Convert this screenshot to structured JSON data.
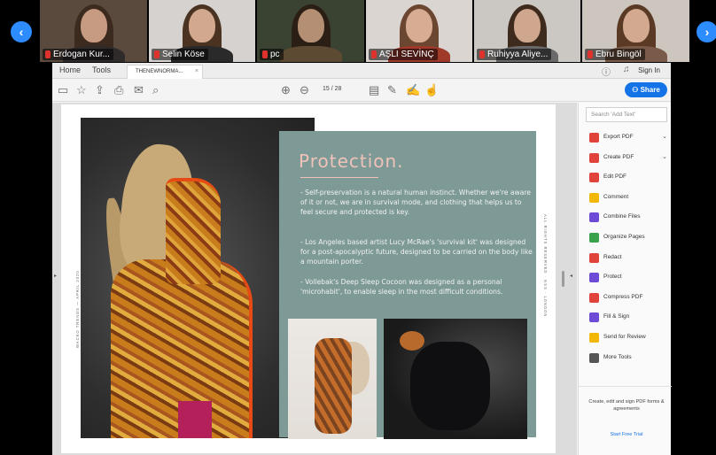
{
  "participants": [
    {
      "name": "Erdogan Kur...",
      "bg": "#5a4a3e",
      "hair": "#3b2a1d",
      "face": "#c79a82",
      "body": "#302b2b"
    },
    {
      "name": "Selin Köse",
      "bg": "#d6d2cf",
      "hair": "#4b3322",
      "face": "#d2a98f",
      "body": "#2a2a2a"
    },
    {
      "name": "pc",
      "bg": "#3a4232",
      "hair": "#2b1e15",
      "face": "#b48f74",
      "body": "#5c4a32"
    },
    {
      "name": "AŞLI SEVİNÇ",
      "bg": "#dad5d0",
      "hair": "#6b4630",
      "face": "#d8ac93",
      "body": "#9f3a2a"
    },
    {
      "name": "Ruhiyya Aliye...",
      "bg": "#cbc7c2",
      "hair": "#3f2b1d",
      "face": "#cfa68e",
      "body": "#6a6a6a"
    },
    {
      "name": "Ebru Bingöl",
      "bg": "#cdc6be",
      "hair": "#5a3a24",
      "face": "#d3aa90",
      "body": "#7a5a48"
    }
  ],
  "nav": {
    "prev": "‹",
    "next": "›"
  },
  "acrobat": {
    "tabs": {
      "home": "Home",
      "tools": "Tools",
      "document": "THENEWNORMA...",
      "close": "×"
    },
    "signin": "Sign In",
    "page_current": "15",
    "page_total": "/ 28",
    "share": "Share",
    "search_placeholder": "Search 'Add Text'",
    "tools": [
      {
        "label": "Export PDF",
        "color": "#e0433a",
        "chevron": true
      },
      {
        "label": "Create PDF",
        "color": "#e0433a",
        "chevron": true
      },
      {
        "label": "Edit PDF",
        "color": "#e0433a",
        "chevron": false
      },
      {
        "label": "Comment",
        "color": "#f2b705",
        "chevron": false
      },
      {
        "label": "Combine Files",
        "color": "#6d4bd6",
        "chevron": false
      },
      {
        "label": "Organize Pages",
        "color": "#3aa24a",
        "chevron": false
      },
      {
        "label": "Redact",
        "color": "#e0433a",
        "chevron": false
      },
      {
        "label": "Protect",
        "color": "#6d4bd6",
        "chevron": false
      },
      {
        "label": "Compress PDF",
        "color": "#e0433a",
        "chevron": false
      },
      {
        "label": "Fill & Sign",
        "color": "#6d4bd6",
        "chevron": false
      },
      {
        "label": "Send for Review",
        "color": "#f2b705",
        "chevron": false
      },
      {
        "label": "More Tools",
        "color": "#555555",
        "chevron": false
      }
    ],
    "promo_text": "Create, edit and sign PDF forms & agreements",
    "promo_link": "Start Free Trial"
  },
  "document": {
    "title": "Protection.",
    "paragraphs": [
      "- Self-preservation is a natural human instinct. Whether we're aware of it or not, we are in survival mode, and clothing that helps us to feel secure and protected is key.",
      "- Los Angeles based artist Lucy McRae's 'survival kit' was designed for a post-apocalyptic future, designed to be carried on the body like a mountain porter.",
      "- Vollebak's Deep Sleep Cocoon was designed as a personal 'microhabit', to enable sleep in the most difficult conditions."
    ],
    "side_left": "WACKO TRENDS — APRIL 2020",
    "side_right": "ALL RIGHTS RESERVED · NSS · LONDON"
  },
  "colors": {
    "accent": "#1473e6",
    "teal": "#7d9a97",
    "title_pink": "#f0c2b8",
    "zoom_blue": "#2d8cff"
  }
}
